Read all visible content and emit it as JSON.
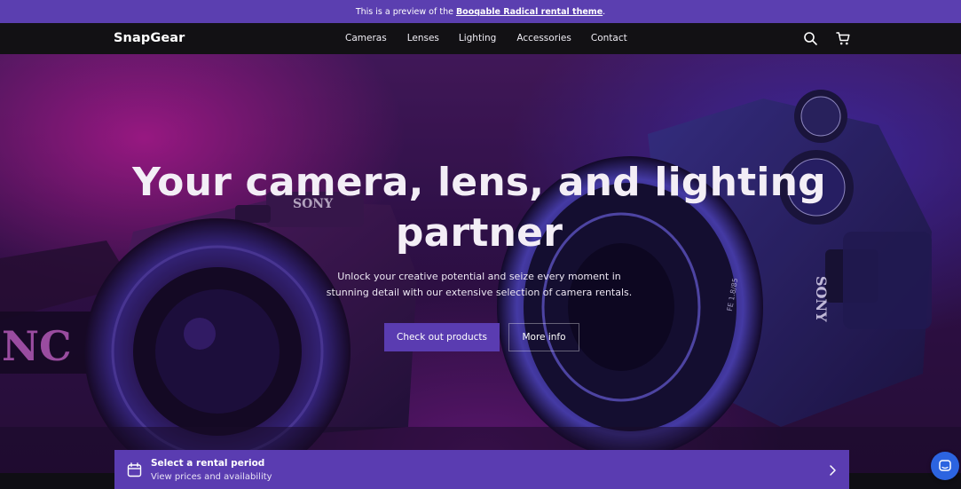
{
  "banner": {
    "prefix": "This is a preview of the",
    "link_text": "Booqable Radical rental theme",
    "suffix": "."
  },
  "nav": {
    "logo": "SnapGear",
    "links": [
      "Cameras",
      "Lenses",
      "Lighting",
      "Accessories",
      "Contact"
    ],
    "icons": [
      "search-icon",
      "cart-icon"
    ]
  },
  "hero": {
    "title_line1": "Your camera, lens, and lighting",
    "title_line2": "partner",
    "subtitle_line1": "Unlock your creative potential and seize every moment in",
    "subtitle_line2": "stunning detail with our extensive selection of camera rentals.",
    "primary_button": "Check out products",
    "secondary_button": "More info"
  },
  "rental": {
    "title": "Select a rental period",
    "subtitle": "View prices and availability",
    "icon": "calendar-icon"
  },
  "chat": {
    "icon": "chat-icon"
  },
  "colors": {
    "accent": "#5a3cb1",
    "banner": "#5b3fb0",
    "navbar": "#121114",
    "chat": "#2c64e0"
  }
}
